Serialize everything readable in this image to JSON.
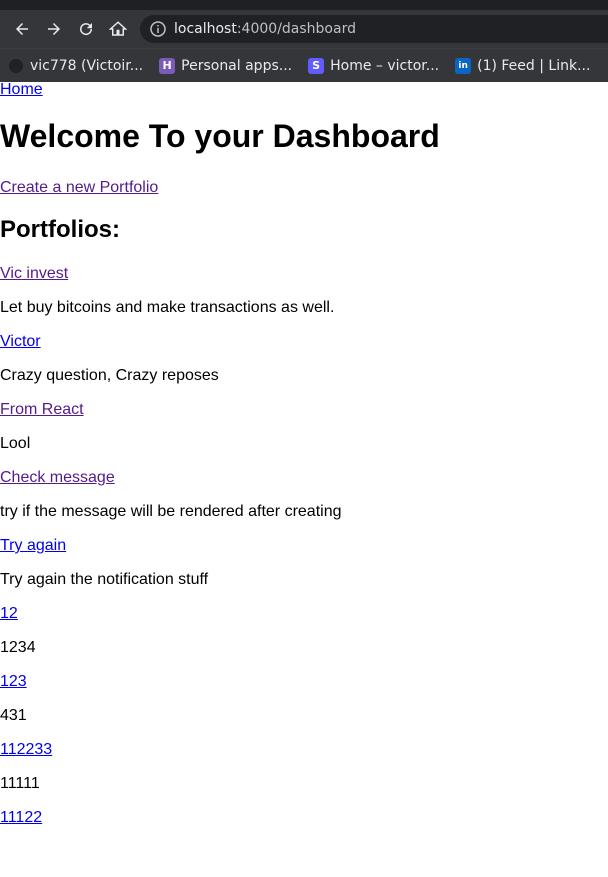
{
  "browser": {
    "url_host": "localhost",
    "url_path": ":4000/dashboard",
    "bookmarks": [
      {
        "label": "vic778 (Victoir...",
        "icon": "github-icon"
      },
      {
        "label": "Personal apps...",
        "icon": "heroku-icon",
        "icon_letter": "H",
        "color": "#7b5bb5"
      },
      {
        "label": "Home – victor...",
        "icon": "stripe-icon",
        "icon_letter": "S",
        "color": "#635bff"
      },
      {
        "label": "(1) Feed | Link...",
        "icon": "linkedin-icon",
        "icon_letter": "in",
        "color": "#0a66c2"
      }
    ]
  },
  "page": {
    "home_link": "Home",
    "title": "Welcome To your Dashboard",
    "create_link": "Create a new Portfolio",
    "portfolios_heading": "Portfolios:",
    "portfolios": [
      {
        "title": "Vic invest",
        "description": "Let buy bitcoins and make transactions as well.",
        "visited": true
      },
      {
        "title": "Victor",
        "description": "Crazy question, Crazy reposes",
        "visited": false
      },
      {
        "title": "From React",
        "description": "Lool",
        "visited": true
      },
      {
        "title": "Check message",
        "description": "try if the message will be rendered after creating",
        "visited": true
      },
      {
        "title": "Try again",
        "description": "Try again the notification stuff",
        "visited": false
      },
      {
        "title": "12",
        "description": "1234",
        "visited": false
      },
      {
        "title": "123",
        "description": "431",
        "visited": false
      },
      {
        "title": "112233",
        "description": "11111",
        "visited": false
      },
      {
        "title": "11122",
        "description": "",
        "visited": false
      }
    ]
  }
}
